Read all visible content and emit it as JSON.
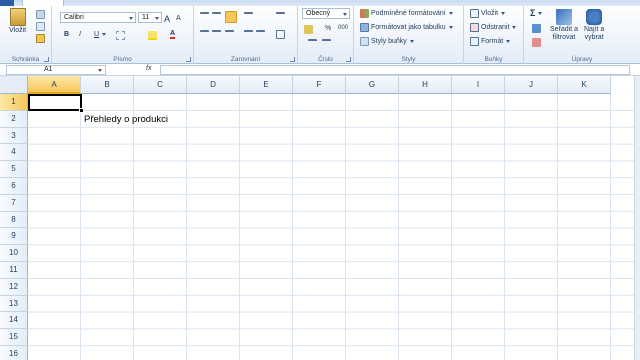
{
  "colors": {
    "accent": "#f6c65a",
    "grid": "#dae3ef",
    "header_bg": "#e4ecf7"
  },
  "ribbon": {
    "clipboard": {
      "label": "Schránka",
      "paste": "Vložit"
    },
    "font": {
      "label": "Písmo",
      "name": "Calibri",
      "size": "11",
      "bold": "B",
      "italic": "I",
      "underline": "U",
      "grow": "A",
      "shrink": "A",
      "color": "A"
    },
    "alignment": {
      "label": "Zarovnání"
    },
    "number": {
      "label": "Číslo",
      "format": "Obecný",
      "percent": "%",
      "thousands": "000"
    },
    "styles": {
      "label": "Styly",
      "conditional": "Podmíněné formátování",
      "as_table": "Formátovat jako tabulku",
      "cell_styles": "Styly buňky"
    },
    "cells": {
      "label": "Buňky",
      "insert": "Vložit",
      "delete": "Odstranit",
      "format": "Formát"
    },
    "editing": {
      "label": "Úpravy",
      "sum": "Σ",
      "sort_line1": "Seřadit a",
      "sort_line2": "filtrovat",
      "find_line1": "Najít a",
      "find_line2": "vybrat"
    }
  },
  "formula_bar": {
    "name_box": "A1",
    "fx": "fx",
    "content": ""
  },
  "sheet": {
    "columns": [
      "A",
      "B",
      "C",
      "D",
      "E",
      "F",
      "G",
      "H",
      "I",
      "J",
      "K"
    ],
    "rows": [
      "1",
      "2",
      "3",
      "4",
      "5",
      "6",
      "7",
      "8",
      "9",
      "10",
      "11",
      "12",
      "13",
      "14",
      "15",
      "16"
    ],
    "selected_cell": "A1",
    "b2": "Přehledy o produkci"
  }
}
